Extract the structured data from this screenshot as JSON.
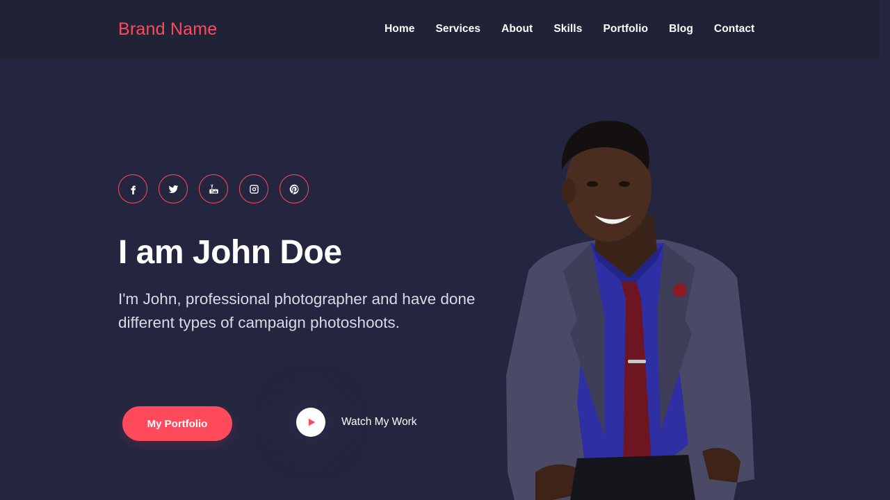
{
  "header": {
    "brand": "Brand Name",
    "nav": [
      {
        "label": "Home"
      },
      {
        "label": "Services"
      },
      {
        "label": "About"
      },
      {
        "label": "Skills"
      },
      {
        "label": "Portfolio"
      },
      {
        "label": "Blog"
      },
      {
        "label": "Contact"
      }
    ]
  },
  "socials": [
    {
      "icon": "facebook-icon"
    },
    {
      "icon": "twitter-icon"
    },
    {
      "icon": "youtube-icon"
    },
    {
      "icon": "instagram-icon"
    },
    {
      "icon": "pinterest-icon"
    }
  ],
  "hero": {
    "title": "I am John Doe",
    "description": "I'm John, professional photographer and have done different types of campaign photoshoots.",
    "primary_button": "My Portfolio",
    "secondary_button": "Watch My Work"
  },
  "colors": {
    "accent": "#ff4a5c",
    "background": "#24263f",
    "header_background": "#202236"
  }
}
